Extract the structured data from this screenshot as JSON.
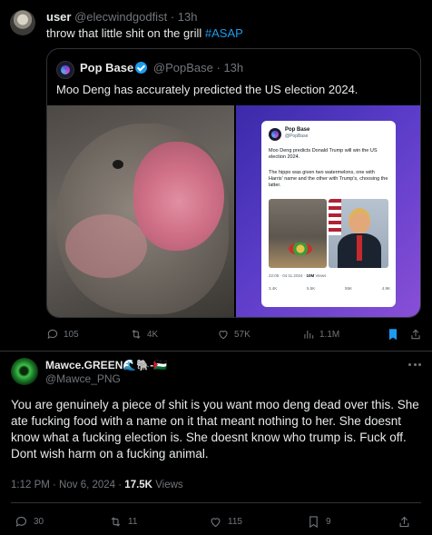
{
  "reply_post": {
    "display_name": "user",
    "handle": "@elecwindgodfist",
    "separator": "·",
    "time": "13h",
    "text": "throw that little shit on the grill",
    "hashtag": "#ASAP",
    "quoted": {
      "display_name": "Pop Base",
      "handle": "@PopBase",
      "separator": "·",
      "time": "13h",
      "text": "Moo Deng has accurately predicted the US election 2024.",
      "embedded_card": {
        "name": "Pop Base",
        "handle": "@PopBase",
        "text1": "Moo Deng predicts Donald Trump will win the US election 2024.",
        "text2": "The hippo was given two watermelons, one with Harris' name and the other with Trump's, choosing the latter.",
        "meta_prefix": "22:05 · 04.11.2024 ·",
        "meta_views": "10M",
        "meta_suffix": "Views",
        "actions": [
          "3.4K",
          "5.5K",
          "55K",
          "4.9K"
        ]
      }
    },
    "actions": {
      "replies": "105",
      "reposts": "4K",
      "likes": "57K",
      "views": "1.1M"
    }
  },
  "main_post": {
    "display_name": "Mawce.GREEN🌊🐘-🇵🇸",
    "handle": "@Mawce_PNG",
    "text": "You are genuinely a piece of shit is you want moo deng dead over this. She ate fucking food with a name on it that meant nothing to her. She doesnt know what a fucking election is. She doesnt know who trump is. Fuck off. Dont wish harm on a fucking animal.",
    "timestamp": "1:12 PM · Nov 6, 2024 ·",
    "views_count": "17.5K",
    "views_label": "Views",
    "actions": {
      "replies": "30",
      "reposts": "11",
      "likes": "115",
      "bookmarks": "9"
    }
  },
  "colors": {
    "background": "#000000",
    "text": "#e7e9ea",
    "muted": "#71767b",
    "link": "#1d9bf0",
    "bookmark_active": "#1d9bf0",
    "border": "#2f3336"
  }
}
